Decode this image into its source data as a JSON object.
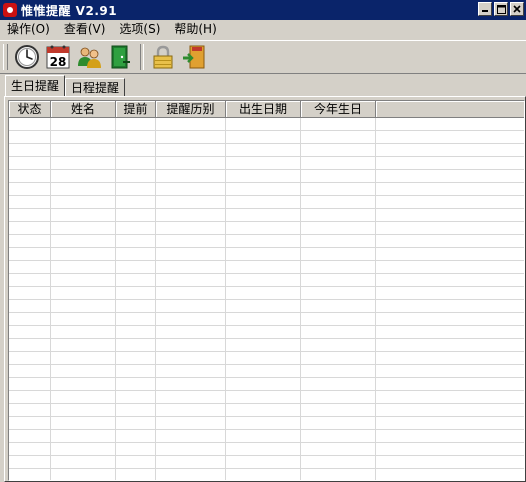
{
  "window": {
    "title": "惟惟提醒 V2.91",
    "colors": {
      "titlebar": "#0a246a",
      "face": "#d4d0c8"
    }
  },
  "window_controls": [
    "minimize-icon",
    "maximize-icon",
    "close-icon"
  ],
  "menu": [
    {
      "label": "操作(O)"
    },
    {
      "label": "查看(V)"
    },
    {
      "label": "选项(S)"
    },
    {
      "label": "帮助(H)"
    }
  ],
  "toolbar": {
    "icons": [
      "clock-icon",
      "calendar-icon",
      "contacts-icon",
      "exit-door-icon",
      "lock-icon",
      "exit-icon"
    ],
    "calendar_number": "28"
  },
  "tabs": [
    {
      "label": "生日提醒",
      "active": true
    },
    {
      "label": "日程提醒",
      "active": false
    }
  ],
  "table": {
    "columns": [
      "状态",
      "姓名",
      "提前",
      "提醒历别",
      "出生日期",
      "今年生日"
    ],
    "rows": []
  }
}
